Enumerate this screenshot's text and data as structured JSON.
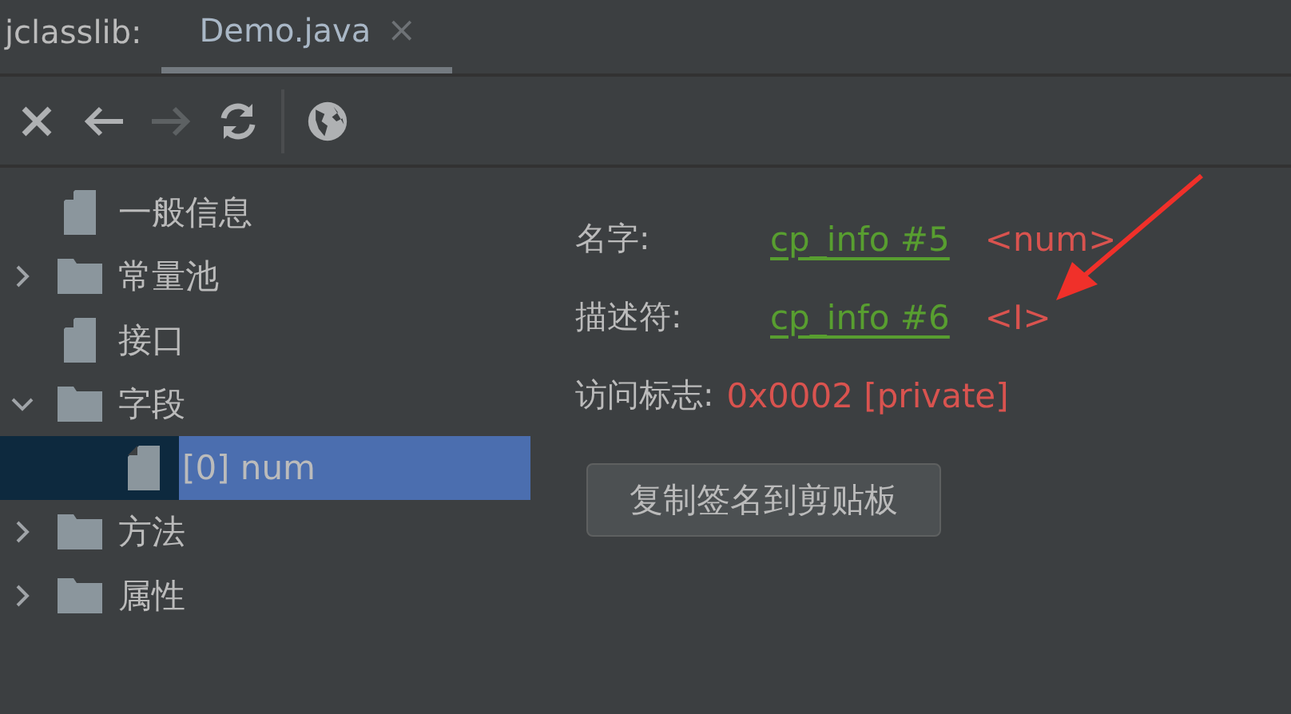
{
  "header": {
    "label": "jclasslib:"
  },
  "tabs": [
    {
      "label": "Demo.java",
      "close": "×",
      "selected": true
    }
  ],
  "toolbar": [
    {
      "kind": "close",
      "disabled": false
    },
    {
      "kind": "back",
      "disabled": false
    },
    {
      "kind": "forward",
      "disabled": true
    },
    {
      "kind": "refresh",
      "disabled": false
    },
    {
      "kind": "web",
      "disabled": false
    }
  ],
  "tree": [
    {
      "label": "一般信息",
      "kind": "doc",
      "selected": false
    },
    {
      "label": "常量池",
      "kind": "folder",
      "expanded": false,
      "selected": false
    },
    {
      "label": "接口",
      "kind": "doc",
      "selected": false
    },
    {
      "label": "字段",
      "kind": "folder",
      "expanded": true,
      "selected": false,
      "children": [
        {
          "label": "[0] num",
          "kind": "doc",
          "selected": true
        }
      ]
    },
    {
      "label": "方法",
      "kind": "folder",
      "expanded": false,
      "selected": false
    },
    {
      "label": "属性",
      "kind": "folder",
      "expanded": false,
      "selected": false
    }
  ],
  "details": [
    {
      "label": "名字:",
      "link": "cp_info #5",
      "value": "<num>"
    },
    {
      "label": "描述符:",
      "link": "cp_info #6",
      "value": "<I>"
    },
    {
      "label": "访问标志:",
      "value": "0x0002 [private]"
    }
  ],
  "copy_button": {
    "label": "复制签名到剪贴板"
  },
  "annotation": {
    "kind": "arrow"
  }
}
